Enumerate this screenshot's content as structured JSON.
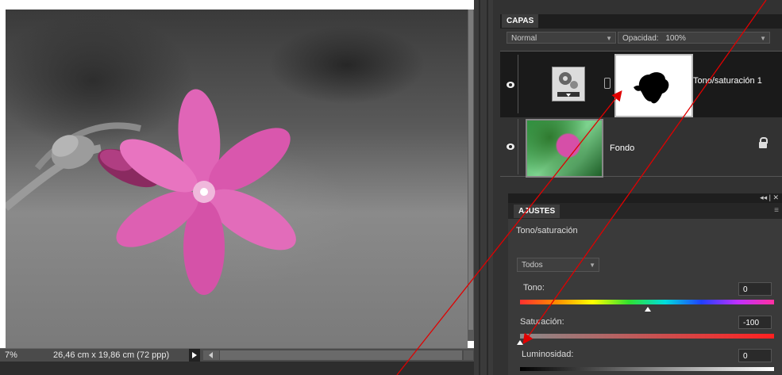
{
  "canvas": {
    "zoom": "7%",
    "doc_info": "26,46 cm x 19,86 cm (72 ppp)"
  },
  "layers_panel": {
    "tab_label": "CAPAS",
    "blend_mode": "Normal",
    "opacity_label": "Opacidad:",
    "opacity_value": "100%",
    "layers": [
      {
        "name": "Tono/saturación 1",
        "locked": false
      },
      {
        "name": "Fondo",
        "locked": true
      }
    ]
  },
  "adjustments_panel": {
    "tab_label": "AJUSTES",
    "collapse_label": "◂◂ | ✕",
    "adjustment_name": "Tono/saturación",
    "channel": "Todos",
    "sliders": [
      {
        "label": "Tono:",
        "value": "0"
      },
      {
        "label": "Saturación:",
        "value": "-100"
      },
      {
        "label": "Luminosidad:",
        "value": "0"
      }
    ]
  },
  "colors": {
    "panel_bg": "#323232",
    "accent_arrow": "#e00000",
    "flower": "#d64fa8"
  }
}
